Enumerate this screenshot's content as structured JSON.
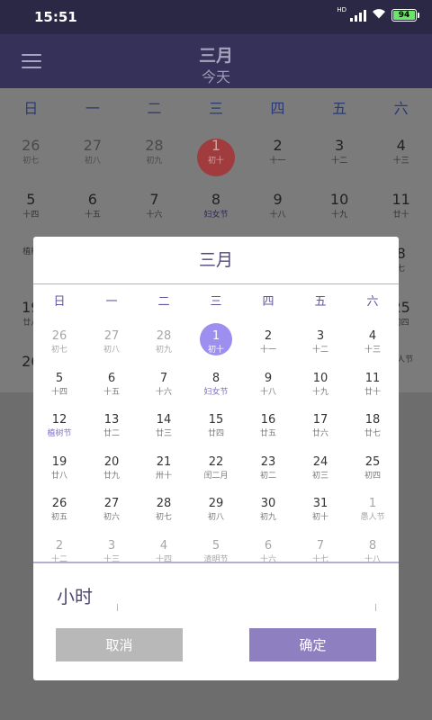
{
  "status": {
    "time": "15:51",
    "network": "HD",
    "battery": "94"
  },
  "header": {
    "title": "三月",
    "subtitle": "今天"
  },
  "weekdays": [
    "日",
    "一",
    "二",
    "三",
    "四",
    "五",
    "六"
  ],
  "background_calendar": {
    "rows": [
      [
        {
          "n": "26",
          "l": "初七",
          "dim": true
        },
        {
          "n": "27",
          "l": "初八",
          "dim": true
        },
        {
          "n": "28",
          "l": "初九",
          "dim": true
        },
        {
          "n": "1",
          "l": "初十",
          "today": true
        },
        {
          "n": "2",
          "l": "十一"
        },
        {
          "n": "3",
          "l": "十二"
        },
        {
          "n": "4",
          "l": "十三"
        }
      ],
      [
        {
          "n": "5",
          "l": "十四"
        },
        {
          "n": "6",
          "l": "十五"
        },
        {
          "n": "7",
          "l": "十六"
        },
        {
          "n": "8",
          "l": "妇女节",
          "fest": true
        },
        {
          "n": "9",
          "l": "十八"
        },
        {
          "n": "10",
          "l": "十九"
        },
        {
          "n": "11",
          "l": "廿十"
        }
      ],
      [
        {
          "n": "",
          "l": "植树"
        },
        {
          "n": "",
          "l": ""
        },
        {
          "n": "",
          "l": ""
        },
        {
          "n": "",
          "l": ""
        },
        {
          "n": "",
          "l": ""
        },
        {
          "n": "",
          "l": ""
        },
        {
          "n": "8",
          "l": "七"
        }
      ],
      [
        {
          "n": "19",
          "l": "廿八"
        },
        {
          "n": "",
          "l": ""
        },
        {
          "n": "",
          "l": ""
        },
        {
          "n": "",
          "l": ""
        },
        {
          "n": "",
          "l": ""
        },
        {
          "n": "",
          "l": ""
        },
        {
          "n": "25",
          "l": "初四"
        }
      ],
      [
        {
          "n": "26",
          "l": ""
        },
        {
          "n": "",
          "l": ""
        },
        {
          "n": "",
          "l": ""
        },
        {
          "n": "",
          "l": ""
        },
        {
          "n": "",
          "l": ""
        },
        {
          "n": "",
          "l": ""
        },
        {
          "n": "",
          "l": "愚人节"
        }
      ]
    ]
  },
  "dialog": {
    "title": "三月",
    "weeks": [
      [
        {
          "n": "26",
          "l": "初七",
          "other": true
        },
        {
          "n": "27",
          "l": "初八",
          "other": true
        },
        {
          "n": "28",
          "l": "初九",
          "other": true
        },
        {
          "n": "1",
          "l": "初十",
          "selected": true
        },
        {
          "n": "2",
          "l": "十一"
        },
        {
          "n": "3",
          "l": "十二"
        },
        {
          "n": "4",
          "l": "十三"
        }
      ],
      [
        {
          "n": "5",
          "l": "十四"
        },
        {
          "n": "6",
          "l": "十五"
        },
        {
          "n": "7",
          "l": "十六"
        },
        {
          "n": "8",
          "l": "妇女节",
          "fest": true
        },
        {
          "n": "9",
          "l": "十八"
        },
        {
          "n": "10",
          "l": "十九"
        },
        {
          "n": "11",
          "l": "廿十"
        }
      ],
      [
        {
          "n": "12",
          "l": "植树节",
          "fest": true
        },
        {
          "n": "13",
          "l": "廿二"
        },
        {
          "n": "14",
          "l": "廿三"
        },
        {
          "n": "15",
          "l": "廿四"
        },
        {
          "n": "16",
          "l": "廿五"
        },
        {
          "n": "17",
          "l": "廿六"
        },
        {
          "n": "18",
          "l": "廿七"
        }
      ],
      [
        {
          "n": "19",
          "l": "廿八"
        },
        {
          "n": "20",
          "l": "廿九"
        },
        {
          "n": "21",
          "l": "卅十"
        },
        {
          "n": "22",
          "l": "闰二月"
        },
        {
          "n": "23",
          "l": "初二"
        },
        {
          "n": "24",
          "l": "初三"
        },
        {
          "n": "25",
          "l": "初四"
        }
      ],
      [
        {
          "n": "26",
          "l": "初五"
        },
        {
          "n": "27",
          "l": "初六"
        },
        {
          "n": "28",
          "l": "初七"
        },
        {
          "n": "29",
          "l": "初八"
        },
        {
          "n": "30",
          "l": "初九"
        },
        {
          "n": "31",
          "l": "初十"
        },
        {
          "n": "1",
          "l": "愚人节",
          "other": true
        }
      ],
      [
        {
          "n": "2",
          "l": "十二",
          "other": true
        },
        {
          "n": "3",
          "l": "十三",
          "other": true
        },
        {
          "n": "4",
          "l": "十四",
          "other": true
        },
        {
          "n": "5",
          "l": "清明节",
          "other": true
        },
        {
          "n": "6",
          "l": "十六",
          "other": true
        },
        {
          "n": "7",
          "l": "十七",
          "other": true
        },
        {
          "n": "8",
          "l": "十八",
          "other": true
        }
      ]
    ],
    "hour_label": "小时",
    "cancel_label": "取消",
    "ok_label": "确定"
  },
  "colors": {
    "accent": "#8e7fc0",
    "selected": "#9d8ff0",
    "header": "#353158"
  }
}
